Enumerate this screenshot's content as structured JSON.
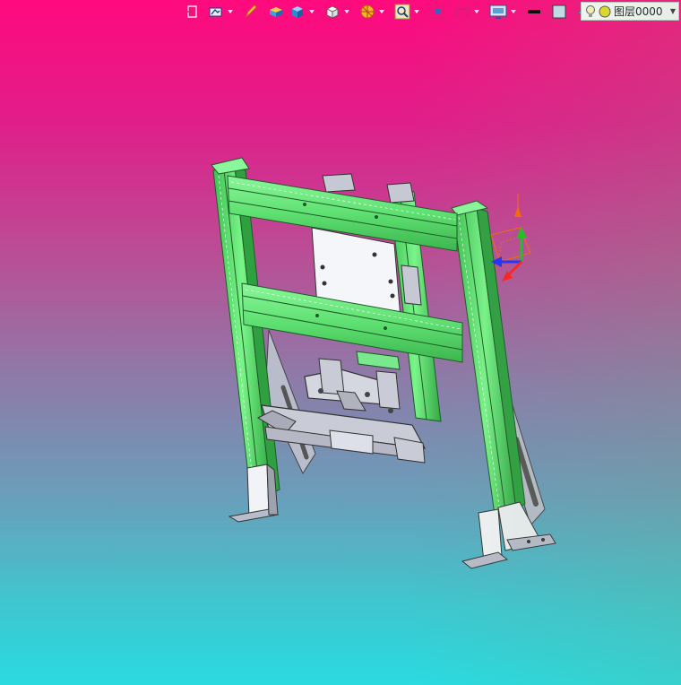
{
  "layer": {
    "name": "图层0000"
  },
  "colors": {
    "frame_green": "#66f07a",
    "frame_dark": "#2c8a3a",
    "part_grey": "#c9ccd6",
    "axis_x": "#ff2020",
    "axis_y": "#20c020",
    "axis_z": "#2030ff"
  },
  "toolbar_icons": [
    "exit-sketch-icon",
    "snap-icon",
    "pen-icon",
    "solid-icon",
    "box-view-icon",
    "wireframe-cube-icon",
    "render-icon",
    "zoom-icon",
    "fit-icon",
    "dimension-icon",
    "display-icon",
    "line-color-icon",
    "fill-color-icon",
    "layer-plane-icon",
    "bulb-icon",
    "layer-color-icon"
  ]
}
